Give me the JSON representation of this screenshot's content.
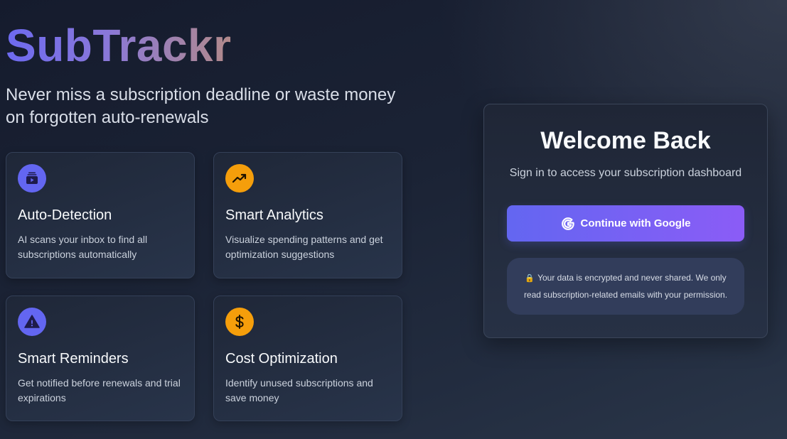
{
  "brand": {
    "name": "SubTrackr",
    "tagline": "Never miss a subscription deadline or waste money on forgotten auto-renewals"
  },
  "features": [
    {
      "icon": "inbox-icon",
      "title": "Auto-Detection",
      "description": "AI scans your inbox to find all subscriptions automatically",
      "color": "#6366f1"
    },
    {
      "icon": "trending-up-icon",
      "title": "Smart Analytics",
      "description": "Visualize spending patterns and get optimization suggestions",
      "color": "#f59e0b"
    },
    {
      "icon": "warning-icon",
      "title": "Smart Reminders",
      "description": "Get notified before renewals and trial expirations",
      "color": "#6366f1"
    },
    {
      "icon": "dollar-icon",
      "title": "Cost Optimization",
      "description": "Identify unused subscriptions and save money",
      "color": "#f59e0b"
    }
  ],
  "login": {
    "heading": "Welcome Back",
    "subheading": "Sign in to access your subscription dashboard",
    "google_button": "Continue with Google",
    "lock_icon": "🔒",
    "privacy_notice": "Your data is encrypted and never shared. We only read subscription-related emails with your permission."
  },
  "colors": {
    "accent": "#6366f1",
    "accent_secondary": "#8b5cf6",
    "warm": "#f59e0b",
    "background": "#1b2335"
  }
}
